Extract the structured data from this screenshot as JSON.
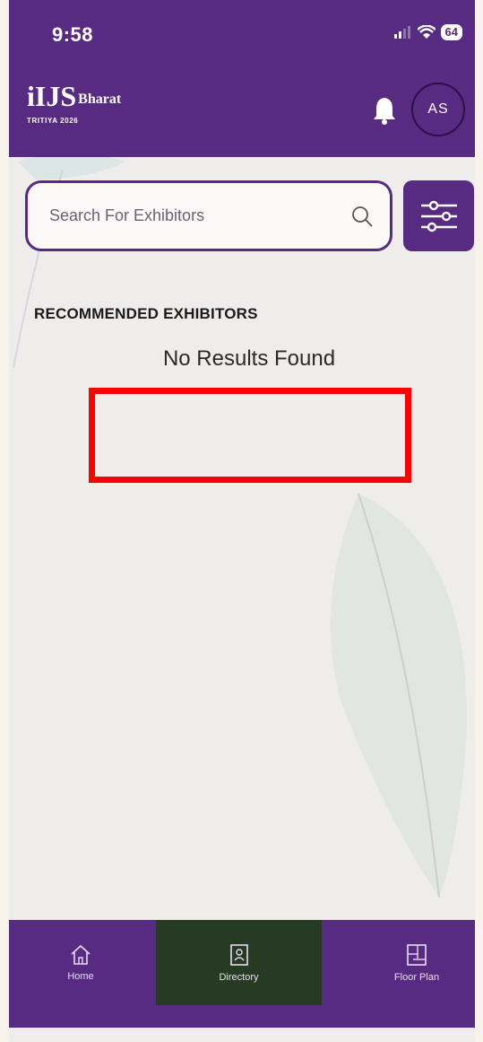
{
  "status_bar": {
    "time": "9:58",
    "battery": "64"
  },
  "header": {
    "logo_main": "iIJS",
    "logo_sub": "Bharat",
    "logo_tagline": "TRITIYA 2026",
    "avatar_initials": "AS"
  },
  "search": {
    "placeholder": "Search For Exhibitors",
    "value": ""
  },
  "section": {
    "title": "RECOMMENDED EXHIBITORS",
    "empty_message": "No Results Found"
  },
  "nav": {
    "items": [
      {
        "label": "Home",
        "icon": "home-icon"
      },
      {
        "label": "Directory",
        "icon": "directory-icon",
        "active": true
      },
      {
        "label": "Floor Plan",
        "icon": "floor-plan-icon"
      }
    ]
  },
  "colors": {
    "brand": "#582b82",
    "active_nav": "#263a24",
    "highlight": "#ff0000"
  }
}
